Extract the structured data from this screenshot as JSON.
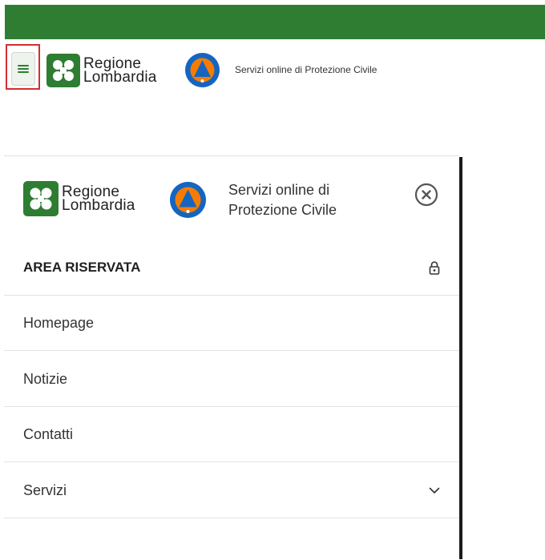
{
  "header": {
    "brand_line1": "Regione",
    "brand_line2": "Lombardia",
    "tagline": "Servizi online di Protezione Civile"
  },
  "drawer": {
    "brand_line1": "Regione",
    "brand_line2": "Lombardia",
    "tagline_line1": "Servizi online di",
    "tagline_line2": "Protezione Civile",
    "items": [
      {
        "label": "AREA RISERVATA",
        "icon": "lock-icon"
      },
      {
        "label": "Homepage"
      },
      {
        "label": "Notizie"
      },
      {
        "label": "Contatti"
      },
      {
        "label": "Servizi",
        "icon": "chevron-down-icon"
      }
    ]
  },
  "colors": {
    "brand_green": "#2e7d32",
    "highlight_red": "#d32f2f",
    "pc_blue": "#1565c0",
    "pc_orange": "#f57c00"
  }
}
